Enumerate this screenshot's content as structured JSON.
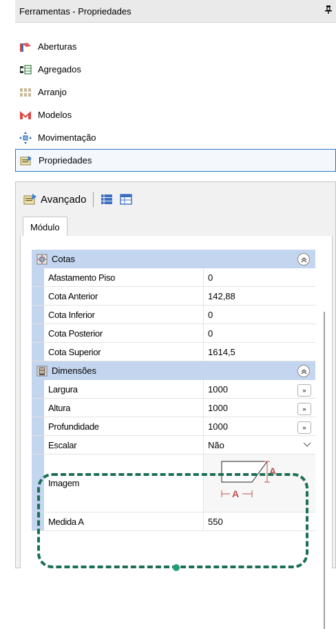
{
  "window": {
    "title": "Ferramentas - Propriedades",
    "pin_symbol": "4"
  },
  "menu": {
    "items": [
      {
        "label": "Aberturas",
        "icon": "aberturas-icon"
      },
      {
        "label": "Agregados",
        "icon": "agregados-icon"
      },
      {
        "label": "Arranjo",
        "icon": "arranjo-icon"
      },
      {
        "label": "Modelos",
        "icon": "modelos-icon"
      },
      {
        "label": "Movimentação",
        "icon": "movimentacao-icon"
      },
      {
        "label": "Propriedades",
        "icon": "propriedades-icon",
        "selected": true
      }
    ]
  },
  "toolbar": {
    "mode_label": "Avançado"
  },
  "tabs": {
    "active": "Módulo"
  },
  "grid": {
    "cotas": {
      "label": "Cotas",
      "collapse_symbol": "˄",
      "rows": [
        {
          "name": "Afastamento Piso",
          "value": "0"
        },
        {
          "name": "Cota Anterior",
          "value": "142,88"
        },
        {
          "name": "Cota Inferior",
          "value": "0"
        },
        {
          "name": "Cota Posterior",
          "value": "0"
        },
        {
          "name": "Cota Superior",
          "value": "1614,5"
        }
      ]
    },
    "dimensoes": {
      "label": "Dimensões",
      "rows": [
        {
          "name": "Largura",
          "value": "1000",
          "button": "»"
        },
        {
          "name": "Altura",
          "value": "1000",
          "button": "»"
        },
        {
          "name": "Profundidade",
          "value": "1000",
          "button": "»"
        },
        {
          "name": "Escalar",
          "value": "Não"
        }
      ],
      "image_row": {
        "name": "Imagem",
        "dim_label_a": "A"
      },
      "medida_row": {
        "name": "Medida A",
        "value": "550"
      }
    }
  },
  "colors": {
    "category_bg": "#c3d5ef",
    "selection_border": "#2a74c4",
    "highlight_dash": "#1c6e55"
  }
}
